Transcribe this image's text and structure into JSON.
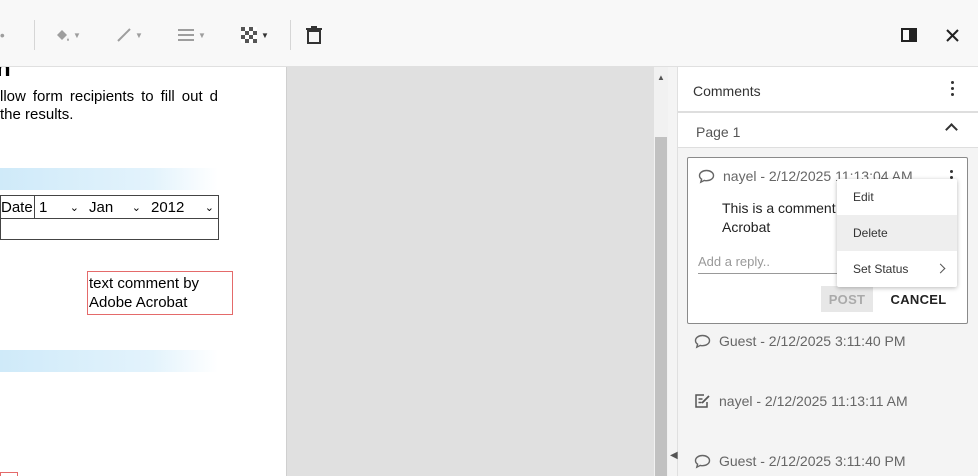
{
  "toolbar": {
    "tools": [
      {
        "icon": "more-dots-icon"
      },
      {
        "icon": "fill-color-icon"
      },
      {
        "icon": "stroke-color-icon"
      },
      {
        "icon": "line-thickness-icon"
      },
      {
        "icon": "opacity-icon"
      },
      {
        "icon": "delete-icon"
      },
      {
        "icon": "toggle-panel-icon"
      },
      {
        "icon": "close-icon"
      }
    ]
  },
  "document": {
    "heading_fragment": "n",
    "paragraph": "llow form recipients to fill out d the results.",
    "form_row": {
      "label": "Date",
      "day": "1",
      "month": "Jan",
      "year": "2012"
    },
    "text_annotation": "text comment by Adobe Acrobat",
    "colors": {
      "annotation_border": "#e46a6a",
      "band": "#cfeaf9"
    }
  },
  "comments_panel": {
    "title": "Comments",
    "page_group": "Page 1",
    "active_comment": {
      "header": "nayel - 2/12/2025 11:13:04 AM",
      "body": "This is a comment Acrobat",
      "body_line1": "This is a comment",
      "body_line2": "Acrobat",
      "reply_placeholder": "Add a reply..",
      "post_label": "POST",
      "cancel_label": "CANCEL"
    },
    "context_menu": {
      "items": [
        "Edit",
        "Delete",
        "Set Status"
      ]
    },
    "other_comments": [
      {
        "header": "Guest - 2/12/2025 3:11:40 PM",
        "icon": "comment-bubble-icon"
      },
      {
        "header": "nayel - 2/12/2025 11:13:11 AM",
        "icon": "edit-note-icon"
      },
      {
        "header": "Guest - 2/12/2025 3:11:40 PM",
        "icon": "comment-bubble-icon"
      }
    ]
  }
}
